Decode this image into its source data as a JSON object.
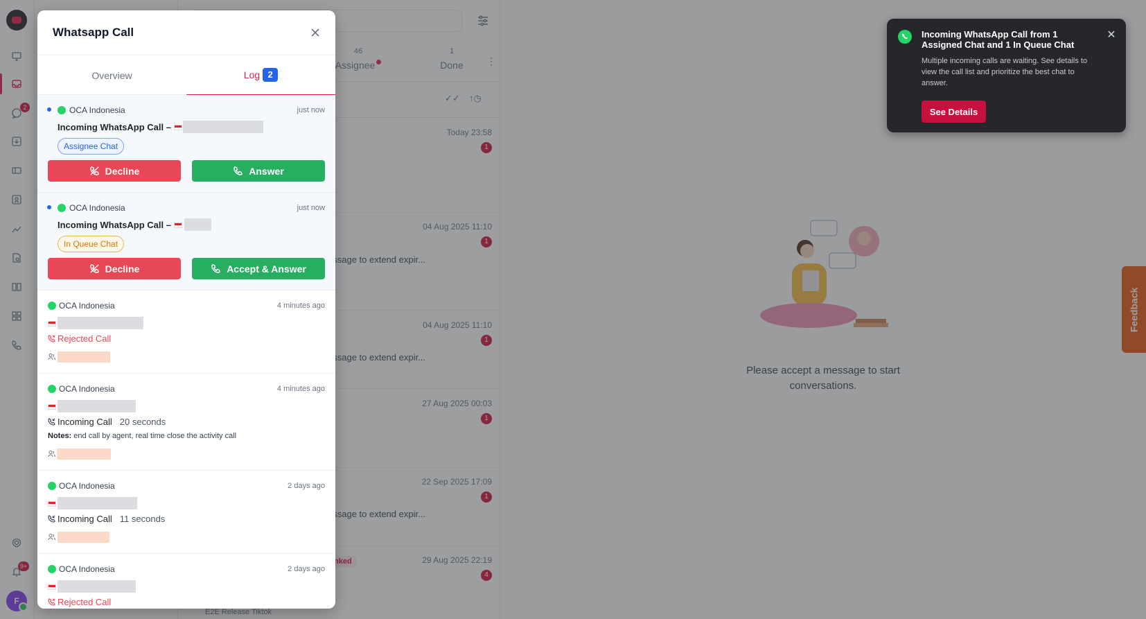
{
  "sidebar": {
    "inbox_badge": "2",
    "notification_badge": "9+",
    "avatar_initial": "F"
  },
  "conversation_list": {
    "tabs": [
      {
        "count": "46",
        "label": "Assignee"
      },
      {
        "count": "1",
        "label": "Done"
      }
    ],
    "items": [
      {
        "time": "Today 23:58",
        "unread": "1",
        "preview": ""
      },
      {
        "time": "04 Aug 2025 11:10",
        "unread": "1",
        "preview": "essage to extend expir..."
      },
      {
        "time": "04 Aug 2025 11:10",
        "unread": "1",
        "preview": "essage to extend expir..."
      },
      {
        "time": "27 Aug 2025 00:03",
        "unread": "1",
        "preview": ""
      },
      {
        "time": "22 Sep 2025 17:09",
        "unread": "1",
        "preview": "essage to extend expir..."
      },
      {
        "time": "29 Aug 2025 22:19",
        "unread": "4",
        "preview": "",
        "tag": "inked"
      }
    ],
    "footer_channel": "E2E Release Tiktok"
  },
  "main": {
    "empty_message": "Please accept a message to start conversations."
  },
  "feedback_label": "Feedback",
  "toast": {
    "title": "Incoming WhatsApp Call from 1 Assigned Chat and 1 In Queue Chat",
    "body": "Multiple incoming calls are waiting. See details to view the call list and prioritize the best chat to answer.",
    "button": "See Details"
  },
  "modal": {
    "title": "Whatsapp Call",
    "tabs": {
      "overview": "Overview",
      "log": "Log",
      "log_count": "2"
    },
    "incoming": [
      {
        "instance": "OCA Indonesia",
        "when": "just now",
        "title": "Incoming WhatsApp Call –",
        "tag": "Assignee Chat",
        "decline": "Decline",
        "answer": "Answer"
      },
      {
        "instance": "OCA Indonesia",
        "when": "just now",
        "title": "Incoming WhatsApp Call –",
        "tag": "In Queue Chat",
        "decline": "Decline",
        "answer": "Accept & Answer"
      }
    ],
    "log": [
      {
        "instance": "OCA Indonesia",
        "when": "4 minutes ago",
        "status": "Rejected Call"
      },
      {
        "instance": "OCA Indonesia",
        "when": "4 minutes ago",
        "status": "Incoming Call",
        "duration": "20 seconds",
        "notes_label": "Notes:",
        "notes": "end call by agent, real time close the activity call"
      },
      {
        "instance": "OCA Indonesia",
        "when": "2 days ago",
        "status": "Incoming Call",
        "duration": "11 seconds"
      },
      {
        "instance": "OCA Indonesia",
        "when": "2 days ago",
        "status": "Rejected Call"
      }
    ]
  },
  "colors": {
    "brand": "#e11d48",
    "decline": "#e84855",
    "answer": "#27ae60",
    "log_badge": "#2563eb",
    "toast_bg": "#25272b",
    "toast_button": "#c8103f",
    "feedback": "#e8540d"
  }
}
